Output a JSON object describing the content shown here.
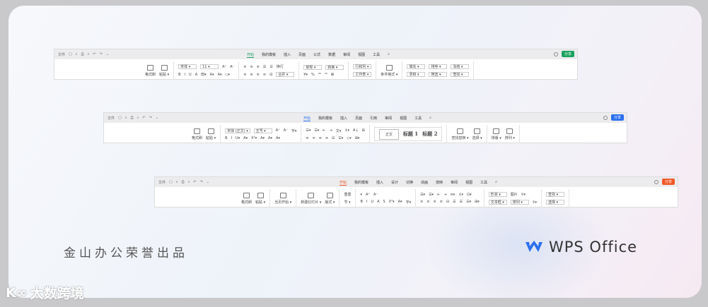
{
  "quick_menu": {
    "file": "文件",
    "icons": [
      "save-icon",
      "share-icon",
      "print-icon",
      "preview-icon",
      "undo-icon",
      "redo-icon",
      "more-icon"
    ]
  },
  "toolbars": [
    {
      "app": "spreadsheet",
      "accent": "#1aa260",
      "share": "分享",
      "tabs": [
        "开始",
        "我的模板",
        "插入",
        "页面",
        "公式",
        "数据",
        "审阅",
        "视图",
        "工具"
      ],
      "active": 0,
      "groups": [
        {
          "type": "big",
          "items": [
            "格式刷",
            "粘贴 ▾"
          ]
        },
        {
          "type": "rows",
          "rows": [
            [
              "宋体 ▾",
              "11 ▾",
              "A⁺",
              "A⁻"
            ],
            [
              "B",
              "I",
              "U",
              "A",
              "田▾",
              "A▾",
              "A▾",
              "◇▾"
            ]
          ]
        },
        {
          "type": "rows",
          "rows": [
            [
              "≡",
              "≡",
              "≡",
              "☰",
              "☰",
              "换行"
            ],
            [
              "≡",
              "≡",
              "≡",
              "≡",
              "⊟",
              "合并 ▾"
            ]
          ]
        },
        {
          "type": "rows",
          "rows": [
            [
              "常规 ▾",
              "转换 ▾"
            ],
            [
              "¥▾",
              "%",
              "⁰⁰",
              "⁰⁰",
              "⊠"
            ]
          ]
        },
        {
          "type": "rows",
          "rows": [
            [
              "行和列 ▾"
            ],
            [
              "工作表 ▾"
            ]
          ]
        },
        {
          "type": "big",
          "items": [
            "条件格式 ▾"
          ]
        },
        {
          "type": "rows",
          "rows": [
            [
              "填充 ▾",
              "排序 ▾",
              "冻结 ▾"
            ],
            [
              "求和 ▾",
              "筛选 ▾",
              "查找 ▾"
            ]
          ]
        }
      ]
    },
    {
      "app": "writer",
      "accent": "#2b6fef",
      "share": "分享",
      "tabs": [
        "开始",
        "我的模板",
        "插入",
        "页面",
        "引用",
        "审阅",
        "视图",
        "工具"
      ],
      "active": 0,
      "groups": [
        {
          "type": "big",
          "items": [
            "格式刷",
            "粘贴 ▾"
          ]
        },
        {
          "type": "rows",
          "rows": [
            [
              "宋体 (正文) ▾",
              "五号 ▾",
              "A⁺",
              "A⁻",
              "字▾"
            ],
            [
              "B",
              "I",
              "U▾",
              "A▾",
              "X²▾",
              "A▾",
              "A▾",
              "A▾"
            ]
          ]
        },
        {
          "type": "rows",
          "rows": [
            [
              "☰▾",
              "☰▾",
              "⇤",
              "⇥",
              "文▾",
              "↕▾",
              "A↓",
              "⊞"
            ],
            [
              "≡",
              "≡",
              "≡",
              "≡",
              "⊟",
              "☰▾",
              "◇▾",
              "⊞▾"
            ]
          ]
        },
        {
          "type": "styles",
          "items": [
            "正文",
            "标题 1",
            "标题 2"
          ]
        },
        {
          "type": "big",
          "items": [
            "查找替换 ▾",
            "选择 ▾"
          ]
        },
        {
          "type": "big",
          "items": [
            "排版 ▾",
            "排列 ▾"
          ]
        }
      ]
    },
    {
      "app": "presentation",
      "accent": "#f0592a",
      "share": "分享",
      "tabs": [
        "开始",
        "我的模板",
        "插入",
        "设计",
        "切换",
        "动画",
        "放映",
        "审阅",
        "视图",
        "工具"
      ],
      "active": 0,
      "groups": [
        {
          "type": "big",
          "items": [
            "格式刷",
            "粘贴 ▾"
          ]
        },
        {
          "type": "big",
          "items": [
            "当页开始 ▾"
          ]
        },
        {
          "type": "big",
          "items": [
            "新建幻灯片 ▾",
            "版式 ▾"
          ]
        },
        {
          "type": "rows",
          "rows": [
            [
              "重置"
            ],
            [
              "节 ▾"
            ]
          ]
        },
        {
          "type": "rows",
          "rows": [
            [
              "▾",
              "A⁺",
              "A⁻"
            ],
            [
              "B",
              "I",
              "U",
              "A",
              "S",
              "X²▾",
              "A▾",
              "字▾"
            ]
          ]
        },
        {
          "type": "rows",
          "rows": [
            [
              "☰▾",
              "☰▾",
              "⇤",
              "⇥",
              "≡▾",
              "↕▾",
              "⊡▾"
            ],
            [
              "≡",
              "≡",
              "≡",
              "≡",
              "⊟",
              "☰",
              "☰",
              "☰▾",
              "⊞▾"
            ]
          ]
        },
        {
          "type": "rows",
          "rows": [
            [
              "形状 ▾",
              "图片",
              "⚲▾"
            ],
            [
              "文本框 ▾",
              "排列 ▾",
              "⚲▾"
            ]
          ]
        },
        {
          "type": "rows",
          "rows": [
            [
              "查找 ▾"
            ],
            [
              "选择 ▾"
            ]
          ]
        }
      ]
    }
  ],
  "footer": {
    "tagline": "金山办公荣誉出品",
    "logo_text": "WPS Office",
    "watermark": "大数跨境"
  }
}
